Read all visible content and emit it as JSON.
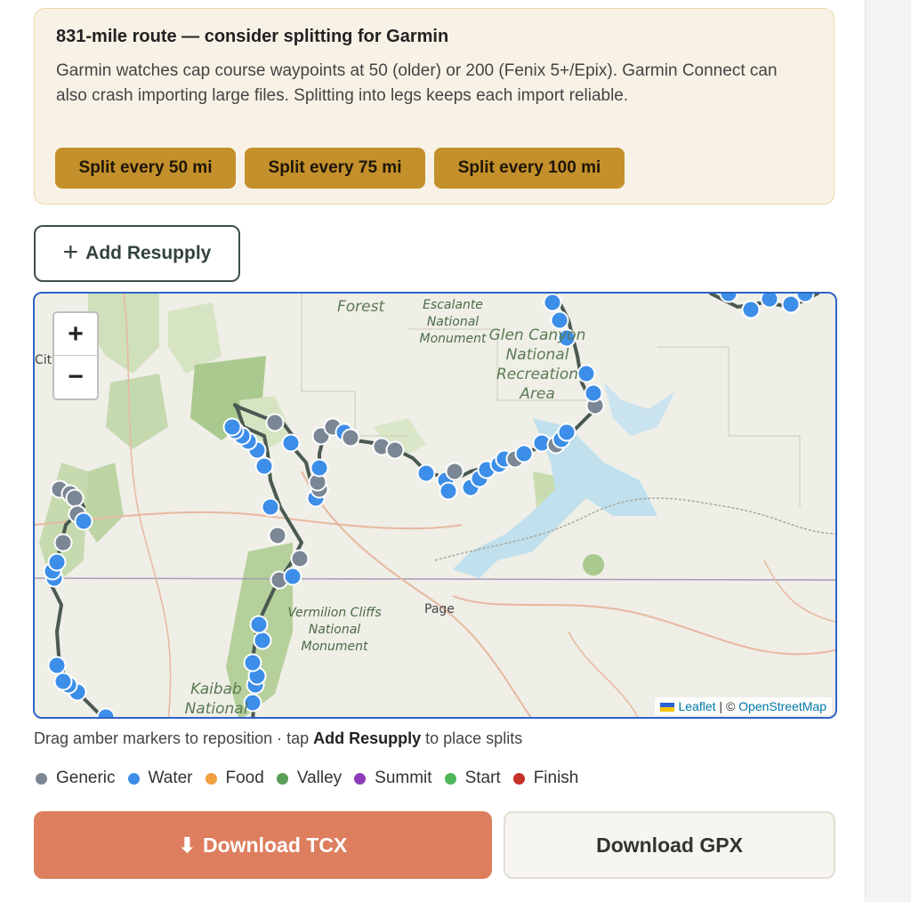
{
  "warning": {
    "title": "831-mile route — consider splitting for Garmin",
    "body": "Garmin watches cap course waypoints at 50 (older) or 200 (Fenix 5+/Epix). Garmin Connect can also crash importing large files. Splitting into legs keeps each import reliable.",
    "buttons": [
      "Split every 50 mi",
      "Split every 75 mi",
      "Split every 100 mi"
    ]
  },
  "add_resupply": {
    "icon": "plus-icon",
    "label": "Add Resupply"
  },
  "map": {
    "zoom_in": "+",
    "zoom_out": "−",
    "labels": {
      "forest": "Forest",
      "escalante": "Escalante National Monument",
      "glen_canyon": "Glen Canyon National Recreation Area",
      "vermilion": "Vermilion Cliffs National Monument",
      "page": "Page",
      "kaibab": "Kaibab National",
      "cit": "Cit"
    },
    "attribution": {
      "leaflet": "Leaflet",
      "sep": " | © ",
      "osm": "OpenStreetMap"
    }
  },
  "caption": {
    "prefix": "Drag amber markers to reposition · tap ",
    "bold": "Add Resupply",
    "suffix": " to place splits"
  },
  "legend": [
    {
      "label": "Generic",
      "color": "#7b8794"
    },
    {
      "label": "Water",
      "color": "#3d8ee8"
    },
    {
      "label": "Food",
      "color": "#f0a040"
    },
    {
      "label": "Valley",
      "color": "#5a9e58"
    },
    {
      "label": "Summit",
      "color": "#8e3db8"
    },
    {
      "label": "Start",
      "color": "#4cb85a"
    },
    {
      "label": "Finish",
      "color": "#c8302a"
    }
  ],
  "downloads": {
    "tcx_icon": "download-arrow-icon",
    "tcx_arrow": "⬇",
    "tcx": "Download TCX",
    "gpx": "Download GPX"
  },
  "colors": {
    "accent": "#c4902b",
    "tcx_button": "#dd7e5f",
    "route_line": "#4a5a52",
    "water_marker": "#3d8ee8",
    "generic_marker": "#7b8794",
    "map_border": "#2f63c6"
  }
}
